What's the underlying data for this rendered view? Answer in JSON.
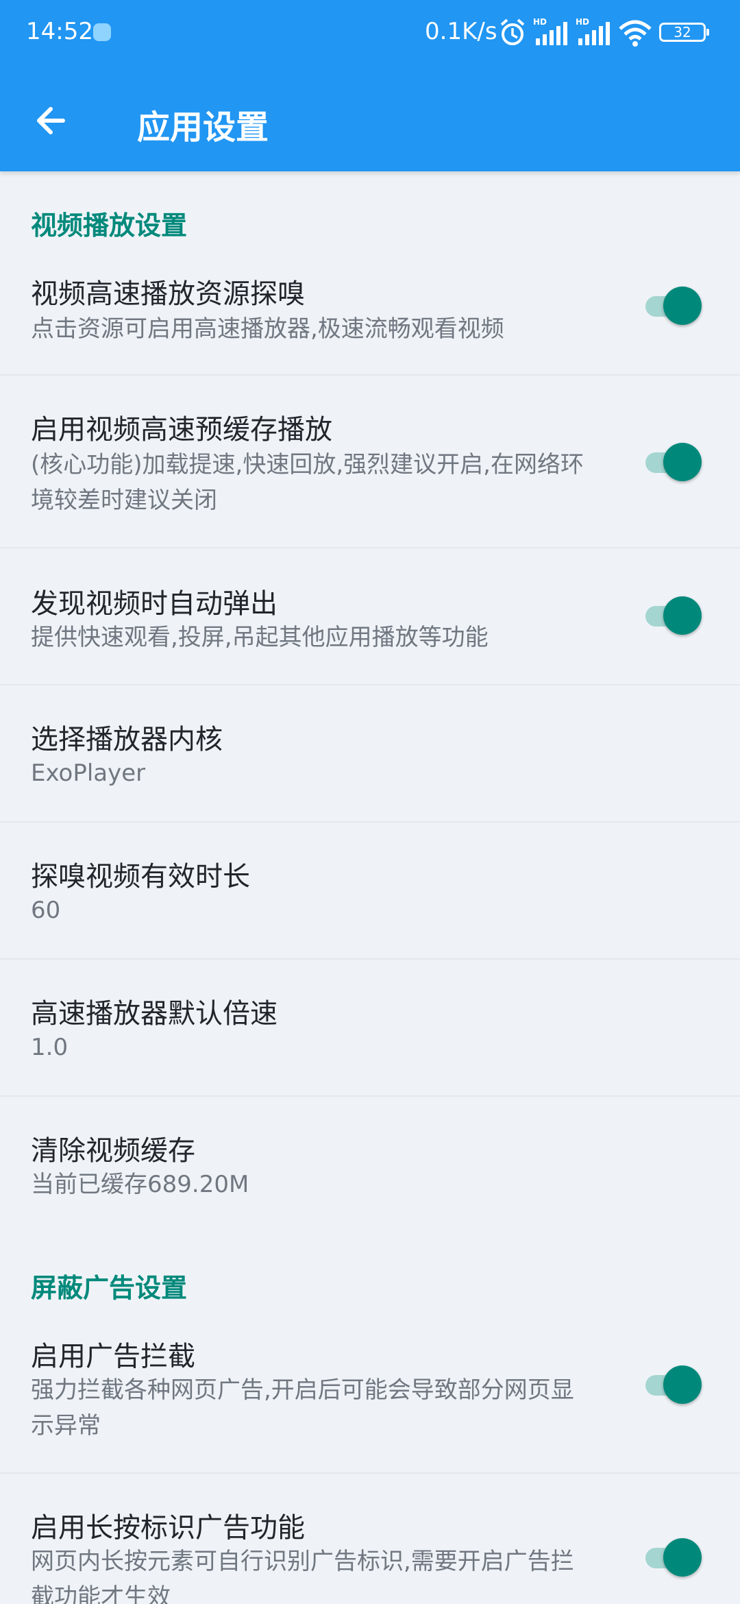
{
  "status_bar": {
    "time": "14:52",
    "net_speed": "0.1K/s",
    "battery": "32",
    "icons": [
      "app-notification-icon",
      "alarm-icon",
      "hd-signal-icon",
      "hd-signal-icon",
      "wifi-icon",
      "battery-icon"
    ]
  },
  "appbar": {
    "title": "应用设置",
    "back_icon": "arrow-left-icon"
  },
  "sections": {
    "video": {
      "header": "视频播放设置"
    },
    "ads": {
      "header": "屏蔽广告设置"
    }
  },
  "prefs": [
    {
      "title": "视频高速播放资源探嗅",
      "summary": "点击资源可启用高速播放器,极速流畅观看视频",
      "switch_on": true
    },
    {
      "title": "启用视频高速预缓存播放",
      "summary": "(核心功能)加载提速,快速回放,强烈建议开启,在网络环境较差时建议关闭",
      "switch_on": true
    },
    {
      "title": "发现视频时自动弹出",
      "summary": "提供快速观看,投屏,吊起其他应用播放等功能",
      "switch_on": true
    },
    {
      "title": "选择播放器内核",
      "summary": "ExoPlayer"
    },
    {
      "title": "探嗅视频有效时长",
      "summary": "60"
    },
    {
      "title": "高速播放器默认倍速",
      "summary": "1.0"
    },
    {
      "title": "清除视频缓存",
      "summary": "当前已缓存689.20M"
    },
    {
      "title": "启用广告拦截",
      "summary": "强力拦截各种网页广告,开启后可能会导致部分网页显示异常",
      "switch_on": true
    },
    {
      "title": "启用长按标识广告功能",
      "summary": "网页内长按元素可自行识别广告标识,需要开启广告拦截功能才生效",
      "switch_on": true
    }
  ],
  "colors": {
    "appbar": "#2196f3",
    "accent": "#00897b",
    "switch_track": "#a4d5d1",
    "background": "#eff3f7"
  }
}
